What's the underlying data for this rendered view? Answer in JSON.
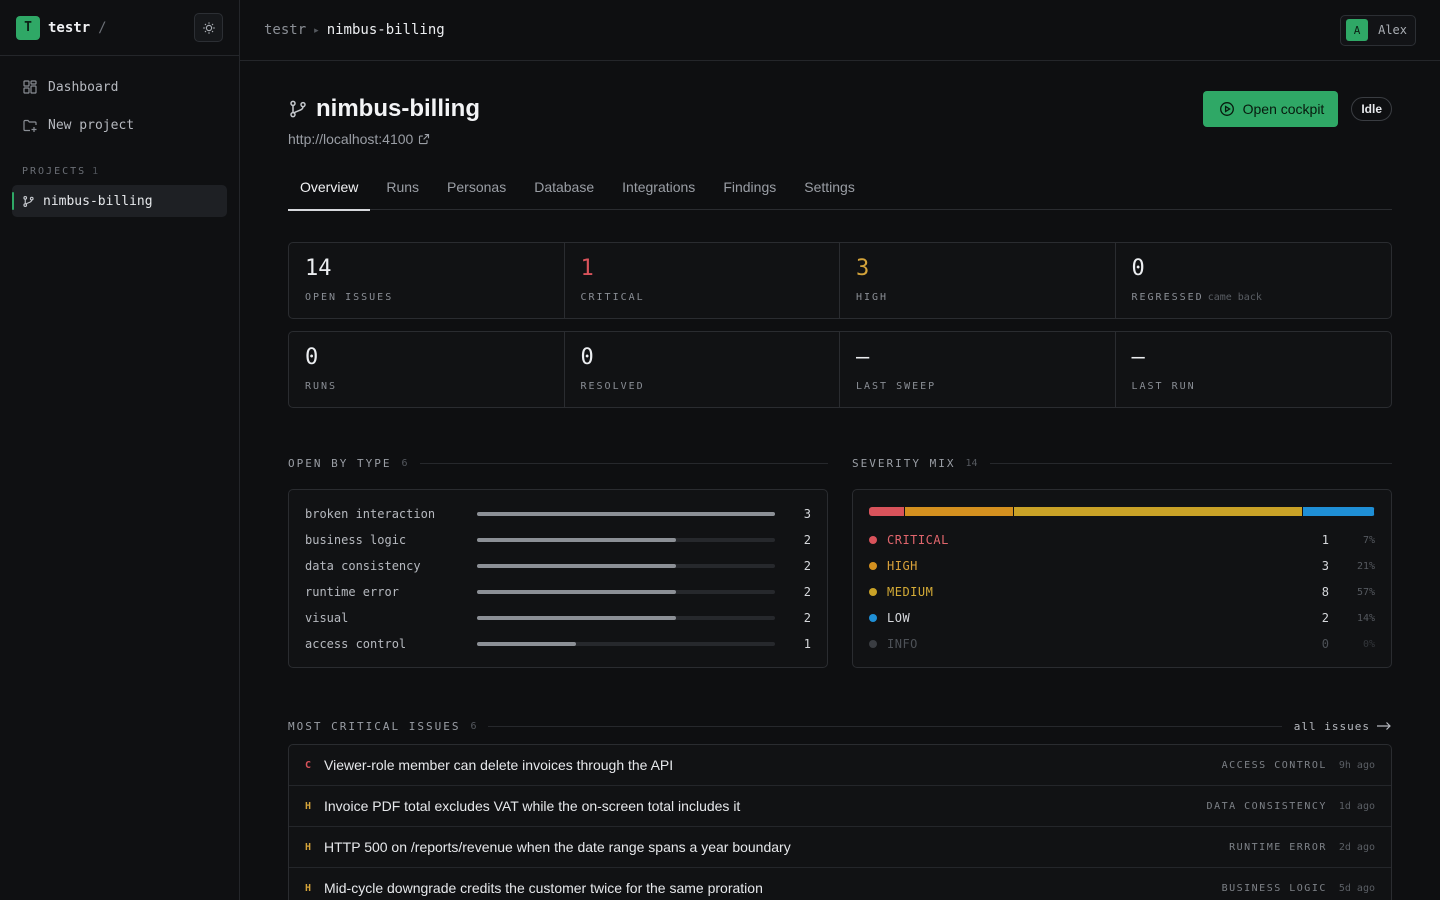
{
  "org": {
    "initial": "T",
    "name": "testr",
    "slash": "/"
  },
  "sidebar": {
    "nav": [
      {
        "label": "Dashboard",
        "icon": "dashboard-icon"
      },
      {
        "label": "New project",
        "icon": "new-project-icon"
      }
    ],
    "projects_label": "PROJECTS",
    "projects_count": "1",
    "projects": [
      {
        "label": "nimbus-billing",
        "icon": "branch-icon",
        "active": true
      }
    ]
  },
  "header": {
    "breadcrumb_root": "testr",
    "breadcrumb_sep": "▸",
    "breadcrumb_current": "nimbus-billing",
    "user": {
      "initial": "A",
      "name": "Alex"
    }
  },
  "project": {
    "title": "nimbus-billing",
    "url": "http://localhost:4100",
    "open_cockpit_label": "Open cockpit",
    "status": "Idle"
  },
  "tabs": [
    {
      "label": "Overview",
      "active": true
    },
    {
      "label": "Runs"
    },
    {
      "label": "Personas"
    },
    {
      "label": "Database"
    },
    {
      "label": "Integrations"
    },
    {
      "label": "Findings"
    },
    {
      "label": "Settings"
    }
  ],
  "stats_row1": [
    {
      "value": "14",
      "label": "OPEN ISSUES",
      "sub": ""
    },
    {
      "value": "1",
      "label": "CRITICAL",
      "sub": "",
      "tone": "red"
    },
    {
      "value": "3",
      "label": "HIGH",
      "sub": "",
      "tone": "amber"
    },
    {
      "value": "0",
      "label": "REGRESSED",
      "sub": "came back"
    }
  ],
  "stats_row2": [
    {
      "value": "0",
      "label": "RUNS",
      "sub": ""
    },
    {
      "value": "0",
      "label": "RESOLVED",
      "sub": ""
    },
    {
      "value": "—",
      "label": "LAST SWEEP",
      "sub": ""
    },
    {
      "value": "—",
      "label": "LAST RUN",
      "sub": ""
    }
  ],
  "open_by_type": {
    "title": "OPEN BY TYPE",
    "count": "6",
    "max": 3,
    "rows": [
      {
        "label": "broken interaction",
        "value": 3
      },
      {
        "label": "business logic",
        "value": 2
      },
      {
        "label": "data consistency",
        "value": 2
      },
      {
        "label": "runtime error",
        "value": 2
      },
      {
        "label": "visual",
        "value": 2
      },
      {
        "label": "access control",
        "value": 1
      }
    ]
  },
  "severity_mix": {
    "title": "SEVERITY MIX",
    "count": "14",
    "rows": [
      {
        "label": "CRITICAL",
        "count": 1,
        "pct": "7%",
        "color": "#d9535b",
        "text_color": "#e0656c"
      },
      {
        "label": "HIGH",
        "count": 3,
        "pct": "21%",
        "color": "#d4901f",
        "text_color": "#d9a13a"
      },
      {
        "label": "MEDIUM",
        "count": 8,
        "pct": "57%",
        "color": "#c9a227",
        "text_color": "#d4ab36"
      },
      {
        "label": "LOW",
        "count": 2,
        "pct": "14%",
        "color": "#1f8fd6",
        "text_color": "#d6d8dc"
      },
      {
        "label": "INFO",
        "count": 0,
        "pct": "0%",
        "color": "#3a3d42",
        "text_color": "#4d5157"
      }
    ]
  },
  "critical_issues": {
    "title": "MOST CRITICAL ISSUES",
    "count": "6",
    "all_link": "all issues",
    "rows": [
      {
        "sev": "C",
        "title": "Viewer-role member can delete invoices through the API",
        "type": "ACCESS CONTROL",
        "age": "9h ago"
      },
      {
        "sev": "H",
        "title": "Invoice PDF total excludes VAT while the on-screen total includes it",
        "type": "DATA CONSISTENCY",
        "age": "1d ago"
      },
      {
        "sev": "H",
        "title": "HTTP 500 on /reports/revenue when the date range spans a year boundary",
        "type": "RUNTIME ERROR",
        "age": "2d ago"
      },
      {
        "sev": "H",
        "title": "Mid-cycle downgrade credits the customer twice for the same proration",
        "type": "BUSINESS LOGIC",
        "age": "5d ago"
      }
    ]
  },
  "colors": {
    "accent": "#2fa866",
    "critical": "#d9535b",
    "high": "#d4a33a",
    "low": "#1f8fd6"
  }
}
